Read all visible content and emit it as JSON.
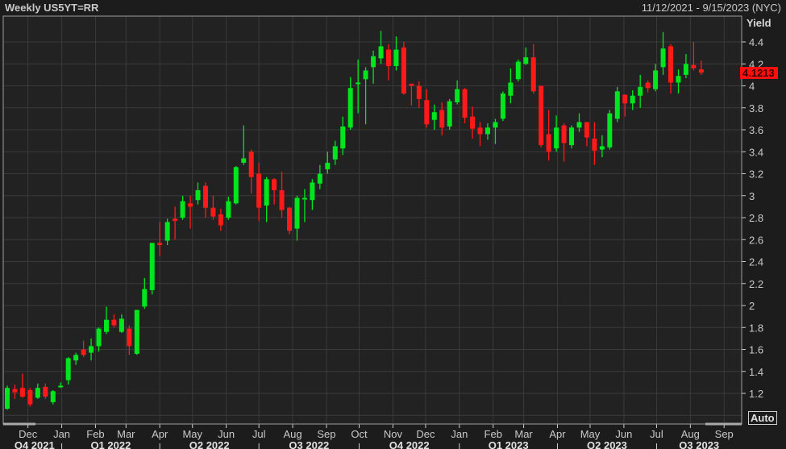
{
  "header": {
    "title": "Weekly US5YT=RR",
    "date_range": "11/12/2021 - 9/15/2023 (NYC)"
  },
  "auto_button": "Auto",
  "last_value": "4.1213",
  "colors": {
    "up": "#00e61e",
    "down": "#ff1a1a",
    "background": "#222222",
    "grid": "#3a3a3a",
    "last_tag": "#ff1010"
  },
  "chart_data": {
    "type": "candlestick",
    "title": "Weekly US5YT=RR",
    "ylabel": "Yield",
    "ylim": [
      1.0,
      4.6
    ],
    "yticks": [
      1.2,
      1.4,
      1.6,
      1.8,
      2,
      2.2,
      2.4,
      2.6,
      2.8,
      3,
      3.2,
      3.4,
      3.6,
      3.8,
      4,
      4.2,
      4.4
    ],
    "grid": true,
    "frequency": "weekly",
    "start_date": "2021-11-12",
    "end_date": "2023-09-15",
    "month_ticks": [
      {
        "label": "Dec",
        "date": "2021-12-01"
      },
      {
        "label": "Jan",
        "date": "2022-01-01"
      },
      {
        "label": "Feb",
        "date": "2022-02-01"
      },
      {
        "label": "Mar",
        "date": "2022-03-01"
      },
      {
        "label": "Apr",
        "date": "2022-04-01"
      },
      {
        "label": "May",
        "date": "2022-05-01"
      },
      {
        "label": "Jun",
        "date": "2022-06-01"
      },
      {
        "label": "Jul",
        "date": "2022-07-01"
      },
      {
        "label": "Aug",
        "date": "2022-08-01"
      },
      {
        "label": "Sep",
        "date": "2022-09-01"
      },
      {
        "label": "Oct",
        "date": "2022-10-01"
      },
      {
        "label": "Nov",
        "date": "2022-11-01"
      },
      {
        "label": "Dec",
        "date": "2022-12-01"
      },
      {
        "label": "Jan",
        "date": "2023-01-01"
      },
      {
        "label": "Feb",
        "date": "2023-02-01"
      },
      {
        "label": "Mar",
        "date": "2023-03-01"
      },
      {
        "label": "Apr",
        "date": "2023-04-01"
      },
      {
        "label": "May",
        "date": "2023-05-01"
      },
      {
        "label": "Jun",
        "date": "2023-06-01"
      },
      {
        "label": "Jul",
        "date": "2023-07-01"
      },
      {
        "label": "Aug",
        "date": "2023-08-01"
      },
      {
        "label": "Sep",
        "date": "2023-09-01"
      }
    ],
    "quarter_labels": [
      {
        "label": "Q4 2021",
        "start": "2021-11-12",
        "end": "2022-01-01"
      },
      {
        "label": "Q1 2022",
        "start": "2022-01-01",
        "end": "2022-04-01"
      },
      {
        "label": "Q2 2022",
        "start": "2022-04-01",
        "end": "2022-07-01"
      },
      {
        "label": "Q3 2022",
        "start": "2022-07-01",
        "end": "2022-10-01"
      },
      {
        "label": "Q4 2022",
        "start": "2022-10-01",
        "end": "2023-01-01"
      },
      {
        "label": "Q1 2023",
        "start": "2023-01-01",
        "end": "2023-04-01"
      },
      {
        "label": "Q2 2023",
        "start": "2023-04-01",
        "end": "2023-07-01"
      },
      {
        "label": "Q3 2023",
        "start": "2023-07-01",
        "end": "2023-09-22"
      }
    ],
    "ohlc": [
      [
        1.06,
        1.27,
        1.05,
        1.25
      ],
      [
        1.24,
        1.28,
        1.15,
        1.21
      ],
      [
        1.25,
        1.38,
        1.16,
        1.17
      ],
      [
        1.23,
        1.25,
        1.08,
        1.1
      ],
      [
        1.16,
        1.29,
        1.15,
        1.25
      ],
      [
        1.26,
        1.29,
        1.15,
        1.17
      ],
      [
        1.12,
        1.23,
        1.1,
        1.22
      ],
      [
        1.26,
        1.3,
        1.25,
        1.27
      ],
      [
        1.32,
        1.53,
        1.28,
        1.52
      ],
      [
        1.5,
        1.57,
        1.46,
        1.55
      ],
      [
        1.6,
        1.68,
        1.53,
        1.55
      ],
      [
        1.57,
        1.7,
        1.5,
        1.63
      ],
      [
        1.63,
        1.8,
        1.58,
        1.79
      ],
      [
        1.76,
        1.99,
        1.74,
        1.87
      ],
      [
        1.87,
        1.92,
        1.8,
        1.82
      ],
      [
        1.76,
        1.92,
        1.75,
        1.88
      ],
      [
        1.79,
        1.82,
        1.55,
        1.63
      ],
      [
        1.56,
        1.96,
        1.55,
        1.96
      ],
      [
        1.99,
        2.25,
        1.97,
        2.15
      ],
      [
        2.14,
        2.57,
        2.1,
        2.57
      ],
      [
        2.57,
        2.76,
        2.45,
        2.55
      ],
      [
        2.59,
        2.79,
        2.55,
        2.76
      ],
      [
        2.79,
        2.9,
        2.6,
        2.77
      ],
      [
        2.8,
        3.0,
        2.78,
        2.95
      ],
      [
        2.93,
        3.0,
        2.7,
        2.9
      ],
      [
        2.96,
        3.12,
        2.92,
        3.05
      ],
      [
        3.09,
        3.12,
        2.8,
        2.89
      ],
      [
        2.89,
        3.0,
        2.78,
        2.81
      ],
      [
        2.83,
        2.88,
        2.68,
        2.73
      ],
      [
        2.8,
        2.99,
        2.78,
        2.95
      ],
      [
        2.93,
        3.27,
        2.92,
        3.26
      ],
      [
        3.3,
        3.64,
        3.28,
        3.34
      ],
      [
        3.4,
        3.42,
        3.02,
        3.17
      ],
      [
        3.2,
        3.3,
        2.77,
        2.89
      ],
      [
        2.91,
        3.17,
        2.76,
        3.15
      ],
      [
        3.15,
        3.16,
        2.92,
        3.05
      ],
      [
        3.05,
        3.22,
        2.8,
        2.87
      ],
      [
        2.89,
        2.9,
        2.65,
        2.68
      ],
      [
        2.7,
        3.0,
        2.59,
        2.98
      ],
      [
        2.97,
        3.06,
        2.76,
        2.98
      ],
      [
        2.96,
        3.15,
        2.87,
        3.12
      ],
      [
        3.11,
        3.28,
        3.06,
        3.2
      ],
      [
        3.24,
        3.4,
        3.2,
        3.3
      ],
      [
        3.33,
        3.5,
        3.28,
        3.45
      ],
      [
        3.43,
        3.72,
        3.37,
        3.63
      ],
      [
        3.62,
        4.08,
        3.6,
        3.98
      ],
      [
        4.02,
        4.24,
        3.75,
        4.03
      ],
      [
        4.06,
        4.17,
        3.65,
        4.14
      ],
      [
        4.17,
        4.32,
        4.02,
        4.27
      ],
      [
        4.25,
        4.5,
        4.2,
        4.36
      ],
      [
        4.33,
        4.38,
        4.05,
        4.18
      ],
      [
        4.18,
        4.45,
        4.14,
        4.33
      ],
      [
        4.35,
        4.4,
        3.92,
        3.93
      ],
      [
        4.02,
        4.02,
        3.82,
        4.0
      ],
      [
        4.0,
        4.04,
        3.8,
        3.88
      ],
      [
        3.87,
        3.97,
        3.62,
        3.65
      ],
      [
        3.69,
        3.83,
        3.6,
        3.76
      ],
      [
        3.78,
        3.85,
        3.55,
        3.62
      ],
      [
        3.63,
        3.88,
        3.6,
        3.86
      ],
      [
        3.85,
        4.05,
        3.83,
        3.97
      ],
      [
        3.97,
        3.98,
        3.66,
        3.71
      ],
      [
        3.72,
        3.81,
        3.52,
        3.61
      ],
      [
        3.62,
        3.67,
        3.45,
        3.56
      ],
      [
        3.56,
        3.66,
        3.51,
        3.62
      ],
      [
        3.62,
        3.7,
        3.47,
        3.67
      ],
      [
        3.7,
        3.95,
        3.68,
        3.93
      ],
      [
        3.91,
        4.16,
        3.84,
        4.03
      ],
      [
        4.06,
        4.24,
        4.04,
        4.22
      ],
      [
        4.2,
        4.35,
        4.19,
        4.26
      ],
      [
        4.26,
        4.38,
        3.93,
        3.95
      ],
      [
        4.0,
        4.0,
        3.44,
        3.46
      ],
      [
        3.56,
        3.78,
        3.32,
        3.4
      ],
      [
        3.43,
        3.73,
        3.4,
        3.62
      ],
      [
        3.64,
        3.66,
        3.31,
        3.48
      ],
      [
        3.46,
        3.64,
        3.43,
        3.62
      ],
      [
        3.62,
        3.75,
        3.58,
        3.67
      ],
      [
        3.67,
        3.67,
        3.45,
        3.53
      ],
      [
        3.52,
        3.67,
        3.28,
        3.41
      ],
      [
        3.42,
        3.55,
        3.35,
        3.45
      ],
      [
        3.44,
        3.78,
        3.42,
        3.75
      ],
      [
        3.7,
        3.99,
        3.67,
        3.95
      ],
      [
        3.92,
        3.92,
        3.72,
        3.84
      ],
      [
        3.84,
        3.96,
        3.78,
        3.91
      ],
      [
        3.91,
        4.1,
        3.8,
        3.99
      ],
      [
        4.03,
        4.05,
        3.94,
        3.98
      ],
      [
        3.97,
        4.2,
        3.95,
        4.14
      ],
      [
        4.17,
        4.49,
        4.1,
        4.34
      ],
      [
        4.36,
        4.38,
        3.93,
        4.03
      ],
      [
        4.03,
        4.15,
        3.93,
        4.09
      ],
      [
        4.1,
        4.29,
        4.07,
        4.2
      ],
      [
        4.19,
        4.4,
        4.14,
        4.16
      ],
      [
        4.15,
        4.23,
        4.1,
        4.12
      ]
    ]
  }
}
